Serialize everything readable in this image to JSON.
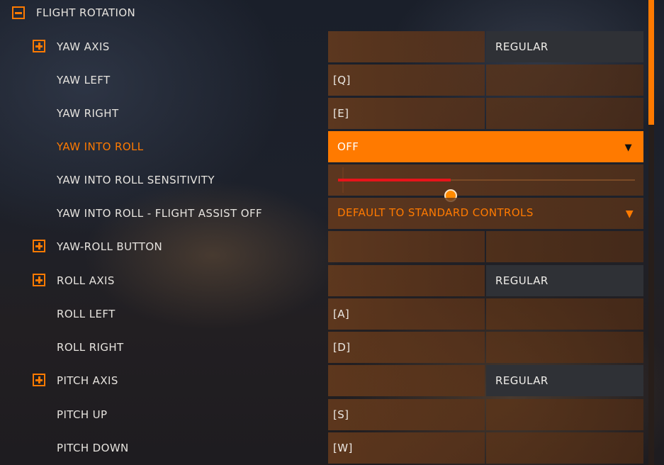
{
  "section": {
    "label": "FLIGHT ROTATION"
  },
  "rows": [
    {
      "label": "YAW AXIS",
      "primary": "",
      "secondary": "REGULAR"
    },
    {
      "label": "YAW LEFT",
      "primary": "[Q]",
      "secondary": ""
    },
    {
      "label": "YAW RIGHT",
      "primary": "[E]",
      "secondary": ""
    },
    {
      "label": "YAW INTO ROLL",
      "value": "OFF"
    },
    {
      "label": "YAW INTO ROLL SENSITIVITY",
      "level_percent": 38
    },
    {
      "label": "YAW INTO ROLL - FLIGHT ASSIST OFF",
      "value": "DEFAULT TO STANDARD CONTROLS"
    },
    {
      "label": "YAW-ROLL BUTTON",
      "primary": "",
      "secondary": ""
    },
    {
      "label": "ROLL AXIS",
      "primary": "",
      "secondary": "REGULAR"
    },
    {
      "label": "ROLL LEFT",
      "primary": "[A]",
      "secondary": ""
    },
    {
      "label": "ROLL RIGHT",
      "primary": "[D]",
      "secondary": ""
    },
    {
      "label": "PITCH AXIS",
      "primary": "",
      "secondary": "REGULAR"
    },
    {
      "label": "PITCH UP",
      "primary": "[S]",
      "secondary": ""
    },
    {
      "label": "PITCH DOWN",
      "primary": "[W]",
      "secondary": ""
    }
  ],
  "icons": {
    "collapse": "minus-box-icon",
    "expand": "plus-box-icon",
    "dropdown": "caret-down-icon"
  },
  "colors": {
    "accent": "#ff7a00",
    "slider_fill": "#e8141a",
    "mode_cell": "#2f3136"
  }
}
